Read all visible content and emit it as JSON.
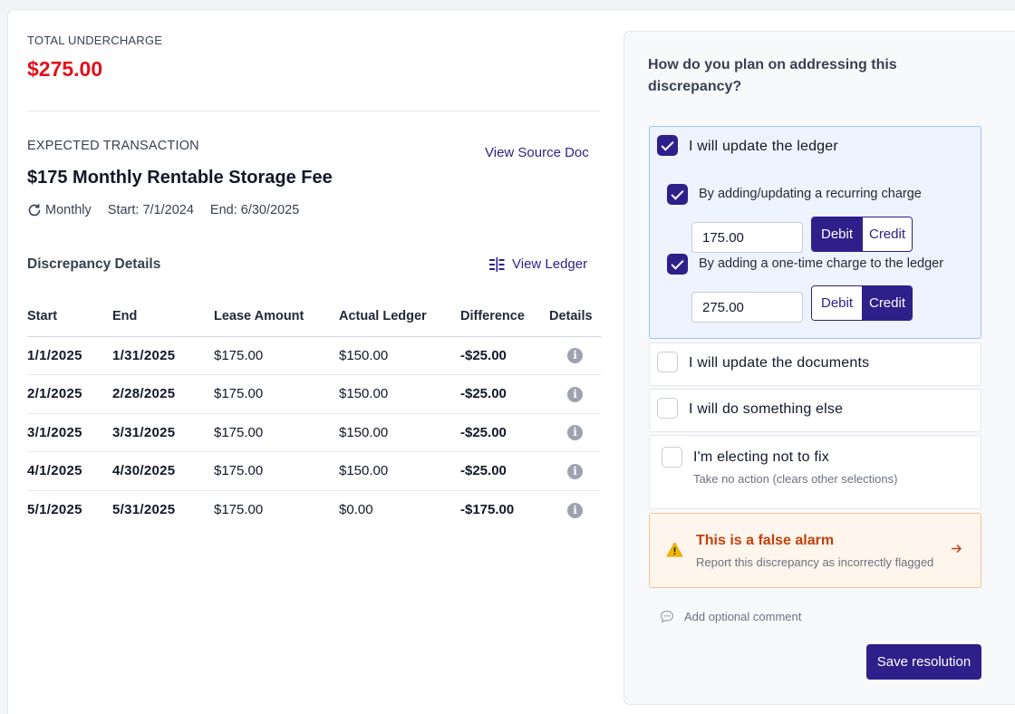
{
  "summary": {
    "label": "TOTAL UNDERCHARGE",
    "amount": "$275.00"
  },
  "expected": {
    "label": "EXPECTED TRANSACTION",
    "view_source": "View Source Doc",
    "title": "$175 Monthly Rentable Storage Fee",
    "frequency": "Monthly",
    "start": "Start: 7/1/2024",
    "end": "End: 6/30/2025"
  },
  "discrepancy": {
    "title": "Discrepancy Details",
    "view_ledger": "View Ledger",
    "columns": [
      "Start",
      "End",
      "Lease Amount",
      "Actual Ledger",
      "Difference",
      "Details"
    ],
    "rows": [
      {
        "start": "1/1/2025",
        "end": "1/31/2025",
        "lease": "$175.00",
        "actual": "$150.00",
        "diff": "-$25.00"
      },
      {
        "start": "2/1/2025",
        "end": "2/28/2025",
        "lease": "$175.00",
        "actual": "$150.00",
        "diff": "-$25.00"
      },
      {
        "start": "3/1/2025",
        "end": "3/31/2025",
        "lease": "$175.00",
        "actual": "$150.00",
        "diff": "-$25.00"
      },
      {
        "start": "4/1/2025",
        "end": "4/30/2025",
        "lease": "$175.00",
        "actual": "$150.00",
        "diff": "-$25.00"
      },
      {
        "start": "5/1/2025",
        "end": "5/31/2025",
        "lease": "$175.00",
        "actual": "$0.00",
        "diff": "-$175.00"
      }
    ]
  },
  "resolution": {
    "question": "How do you plan on addressing this discrepancy?",
    "opt_ledger": "I will update the ledger",
    "sub_recurring": "By adding/updating a recurring charge",
    "recurring_amount": "175.00",
    "sub_onetime": "By adding a one-time charge to the ledger",
    "onetime_amount": "275.00",
    "debit": "Debit",
    "credit": "Credit",
    "opt_documents": "I will update the documents",
    "opt_else": "I will do something else",
    "opt_nofix": "I'm electing not to fix",
    "opt_nofix_sub": "Take no action (clears other selections)",
    "alarm_title": "This is a false alarm",
    "alarm_sub": "Report this discrepancy as incorrectly flagged",
    "comment": "Add optional comment",
    "save": "Save resolution"
  },
  "colors": {
    "accent": "#2e1f8a",
    "negative": "#e0233a",
    "warning": "#c2410c"
  }
}
